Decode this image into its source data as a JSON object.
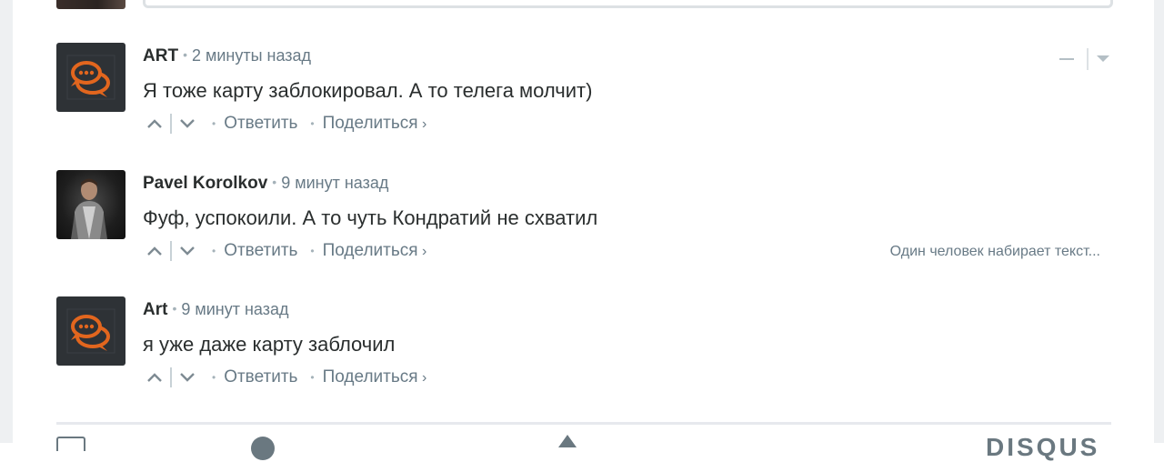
{
  "comments": [
    {
      "author": "ART",
      "time": "2 минуты назад",
      "text": "Я тоже карту заблокировал. А то телега молчит)",
      "reply_label": "Ответить",
      "share_label": "Поделиться",
      "avatar_icon": "chat-bubbles-logo-icon"
    },
    {
      "author": "Pavel Korolkov",
      "time": "9 минут назад",
      "text": "Фуф, успокоили. А то чуть Кондратий не схватил",
      "reply_label": "Ответить",
      "share_label": "Поделиться",
      "avatar_icon": "user-photo-avatar"
    },
    {
      "author": "Art",
      "time": "9 минут назад",
      "text": "я уже даже карту заблочил",
      "reply_label": "Ответить",
      "share_label": "Поделиться",
      "avatar_icon": "chat-bubbles-logo-icon"
    }
  ],
  "typing_indicator": "Один человек набирает текст...",
  "footer": {
    "brand": "DISQUS"
  },
  "colors": {
    "accent_orange": "#e2661e",
    "logo_bg": "#2e3236",
    "text_primary": "#2a2e2e",
    "text_muted": "#687a86"
  }
}
